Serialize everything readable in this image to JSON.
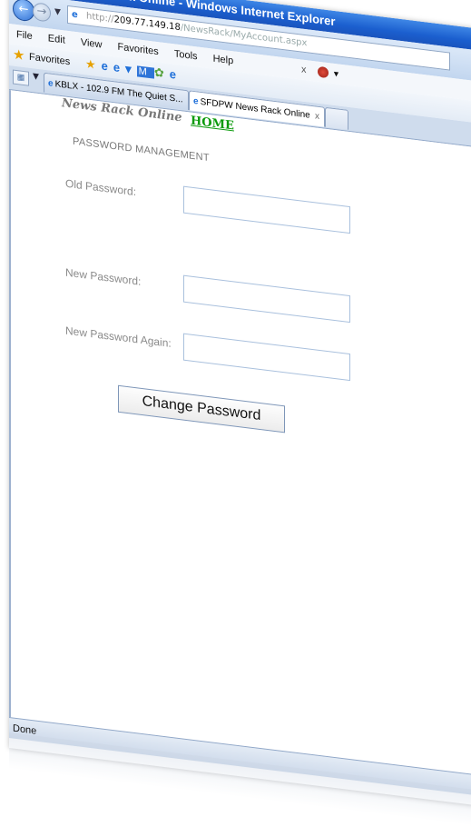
{
  "window": {
    "title": "SFDPW News Rack Online - Windows Internet Explorer"
  },
  "address": {
    "url_prefix": "http://",
    "url_host": "209.77.149.18",
    "url_path": "/NewsRack/MyAccount.aspx"
  },
  "menu": {
    "items": [
      {
        "label": "File"
      },
      {
        "label": "Edit"
      },
      {
        "label": "View"
      },
      {
        "label": "Favorites"
      },
      {
        "label": "Tools"
      },
      {
        "label": "Help"
      }
    ]
  },
  "favorites_bar": {
    "label": "Favorites"
  },
  "tabs": [
    {
      "label": "KBLX - 102.9 FM The Quiet S...",
      "active": false
    },
    {
      "label": "SFDPW News Rack Online",
      "active": true
    }
  ],
  "page": {
    "brand": "News Rack Online",
    "home_link": "HOME",
    "section_title": "PASSWORD MANAGEMENT",
    "fields": [
      {
        "label": "Old Password:",
        "value": ""
      },
      {
        "label": "New Password:",
        "value": ""
      },
      {
        "label": "New Password Again:",
        "value": ""
      }
    ],
    "submit_label": "Change Password"
  },
  "status": {
    "text": "Done"
  },
  "colors": {
    "titlebar": "#1b5fcf",
    "home_link": "#0a9a0a"
  }
}
